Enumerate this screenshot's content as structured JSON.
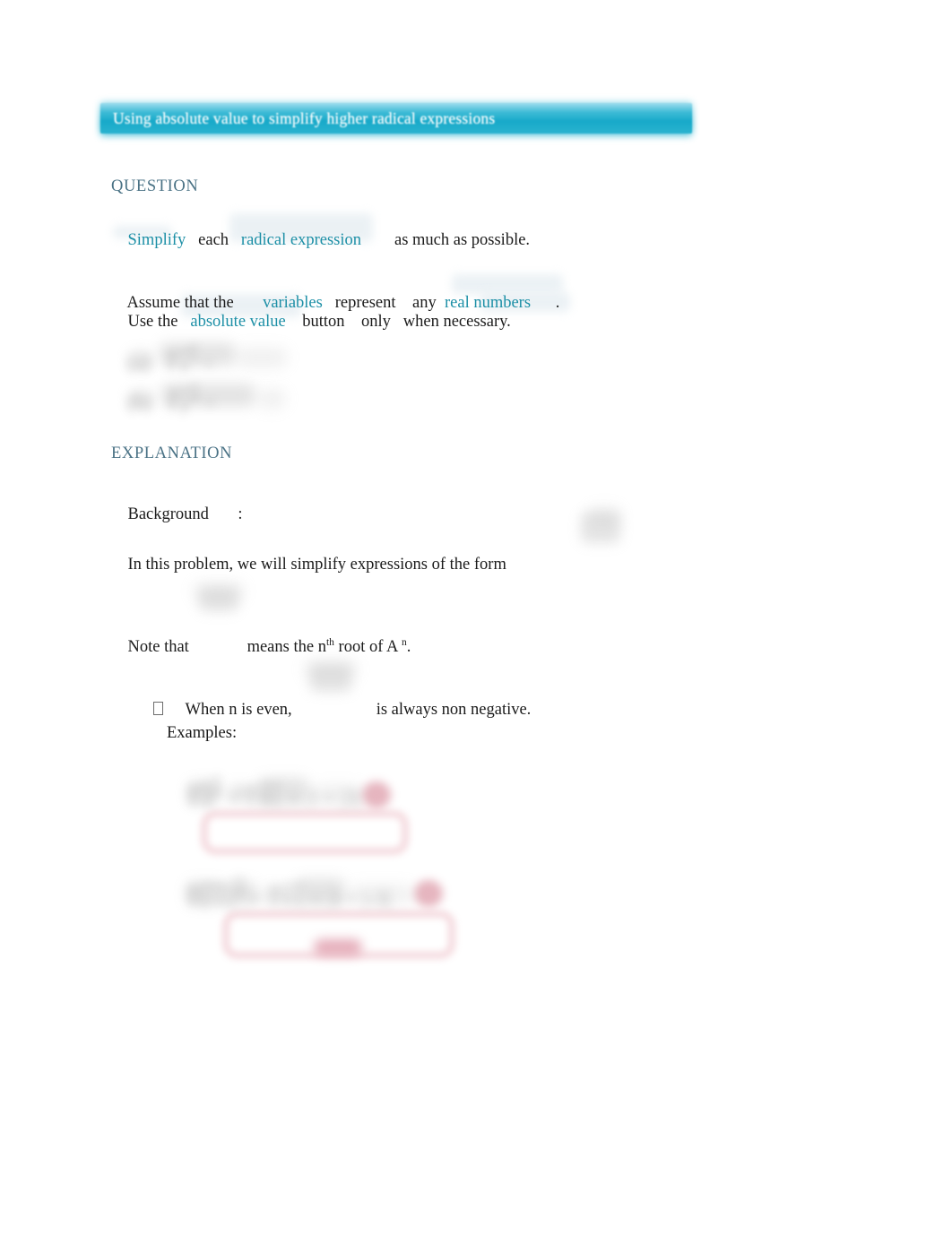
{
  "document": {
    "title_bar": {
      "text": "Using absolute value to simplify higher radical expressions",
      "background_color": "#17a9c9",
      "text_color": "#ffffff"
    },
    "colors": {
      "heading": "#4a7285",
      "link": "#1c8fa6",
      "body_text": "#1b1b1b",
      "annotation_red": "#e6a7b2",
      "page_background": "#ffffff"
    },
    "sections": [
      {
        "id": "question",
        "heading": "QUESTION",
        "lines": [
          {
            "id": "simplify-line",
            "parts": [
              {
                "text": "Simplify",
                "style": "link"
              },
              {
                "text": "   each   ",
                "style": "plain"
              },
              {
                "text": "radical expression",
                "style": "link"
              },
              {
                "text": "        as much as possible.",
                "style": "plain"
              }
            ]
          },
          {
            "id": "assume-line",
            "parts": [
              {
                "text": "Assume that the       ",
                "style": "plain"
              },
              {
                "text": "variables",
                "style": "link"
              },
              {
                "text": "   represent    any  ",
                "style": "plain"
              },
              {
                "text": "real numbers",
                "style": "link"
              },
              {
                "text": "      .",
                "style": "plain"
              }
            ]
          },
          {
            "id": "use-line",
            "parts": [
              {
                "text": "Use the   ",
                "style": "plain"
              },
              {
                "text": "absolute value",
                "style": "link"
              },
              {
                "text": "    button    only   when necessary.",
                "style": "plain"
              }
            ]
          }
        ],
        "answer_choices": [
          {
            "label": "(a)",
            "content": "redacted radical expression",
            "state": "blurred"
          },
          {
            "label": "(b)",
            "content": "redacted radical expression",
            "state": "blurred"
          }
        ]
      },
      {
        "id": "explanation",
        "heading": "EXPLANATION",
        "lines": [
          {
            "id": "background-line",
            "parts": [
              {
                "text": "Background",
                "style": "plain"
              },
              {
                "text": "       :",
                "style": "plain"
              }
            ]
          },
          {
            "id": "inthis-line",
            "parts": [
              {
                "text": "In this problem, we will simplify expressions of the form",
                "style": "plain"
              }
            ],
            "trailing_math": {
              "content": "redacted radical expression",
              "state": "blurred"
            }
          },
          {
            "id": "note-line",
            "parts": [
              {
                "text": "Note that",
                "style": "plain"
              },
              {
                "text": "              means the n",
                "style": "plain"
              },
              {
                "text": "th",
                "style": "superscript"
              },
              {
                "text": " root of A ",
                "style": "plain"
              },
              {
                "text": "n",
                "style": "superscript"
              },
              {
                "text": ".",
                "style": "plain"
              }
            ],
            "inline_math": {
              "content": "redacted nth root notation",
              "state": "blurred"
            }
          }
        ],
        "bullets": [
          {
            "marker": "missing-glyph-box",
            "text_before": "When n is even,",
            "inline_math": {
              "content": "redacted radical expression",
              "state": "blurred"
            },
            "text_after": "is always non negative."
          }
        ],
        "examples_label": "Examples:",
        "examples": [
          {
            "id": "example-1",
            "equation": {
              "content": "redacted worked example equation",
              "state": "blurred"
            },
            "annotation": {
              "shape": "rounded-rectangle",
              "color": "#e6a7b2",
              "label": ""
            }
          },
          {
            "id": "example-2",
            "equation": {
              "content": "redacted worked example equation",
              "state": "blurred"
            },
            "annotation": {
              "shape": "rounded-rectangle",
              "color": "#e6a7b2",
              "label": "redacted note chip"
            }
          }
        ]
      }
    ]
  }
}
